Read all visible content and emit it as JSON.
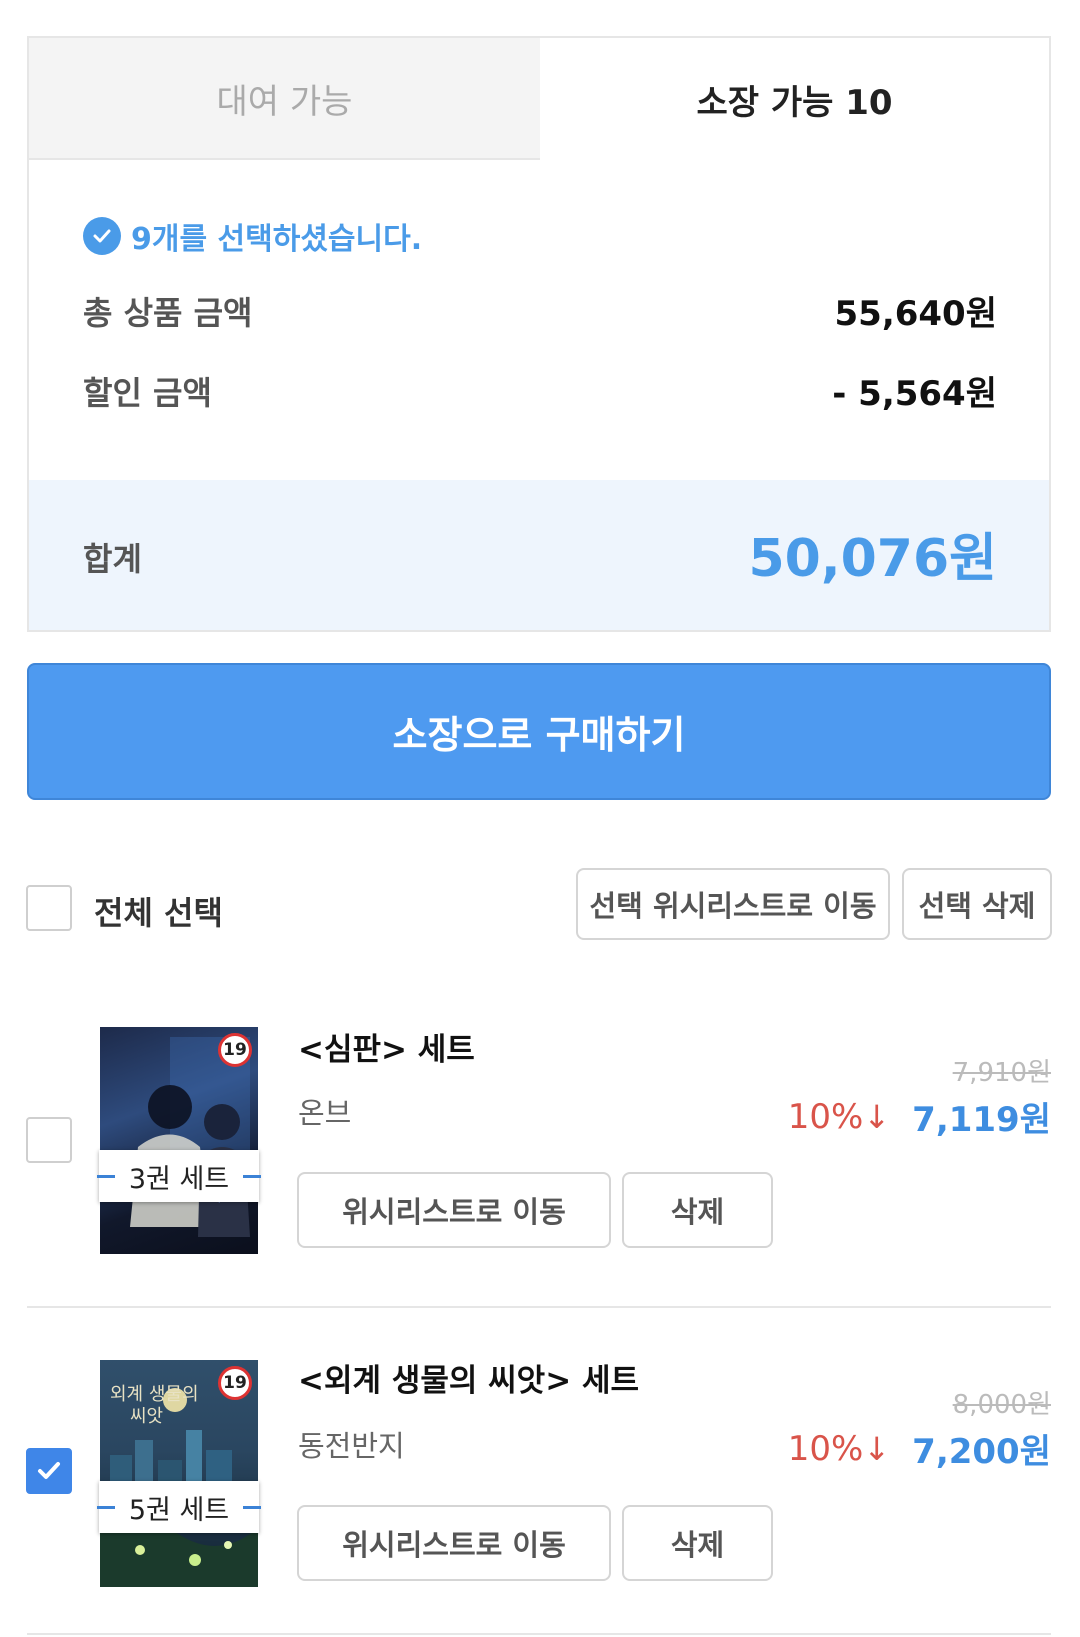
{
  "tabs": {
    "rent": "대여 가능",
    "own": "소장 가능 10"
  },
  "summary": {
    "selected_text": "9개를 선택하셨습니다.",
    "total_label": "총 상품 금액",
    "total_value": "55,640원",
    "discount_label": "할인 금액",
    "discount_value": "- 5,564원",
    "sum_label": "합계",
    "sum_value": "50,076원"
  },
  "buy_button": "소장으로 구매하기",
  "select_bar": {
    "select_all": "전체 선택",
    "move_wishlist": "선택 위시리스트로 이동",
    "delete": "선택 삭제"
  },
  "items": [
    {
      "title": "<심판> 세트",
      "author": "온브",
      "set_label": "3권 세트",
      "age_badge": "19",
      "original_price": "7,910원",
      "discount": "10%",
      "price": "7,119원",
      "wishlist_btn": "위시리스트로 이동",
      "delete_btn": "삭제",
      "checked": false
    },
    {
      "title": "<외계 생물의 씨앗> 세트",
      "author": "동전반지",
      "set_label": "5권 세트",
      "age_badge": "19",
      "original_price": "8,000원",
      "discount": "10%",
      "price": "7,200원",
      "wishlist_btn": "위시리스트로 이동",
      "delete_btn": "삭제",
      "checked": true
    }
  ],
  "colors": {
    "accent": "#4a9be8",
    "button": "#4e9af0",
    "discount": "#d9544a",
    "price": "#3e8de0"
  }
}
